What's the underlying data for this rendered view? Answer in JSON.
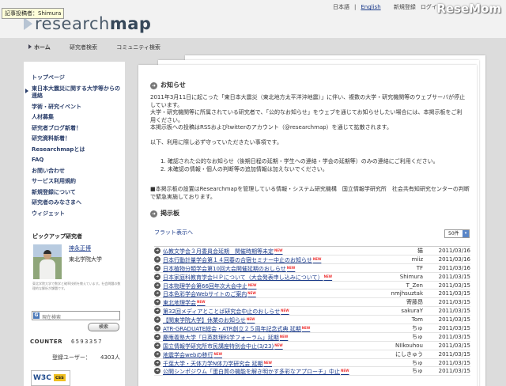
{
  "header": {
    "tooltip": "記事投稿者：Shimura",
    "logo_light": "research",
    "logo_bold": "map",
    "lang_ja": "日本語",
    "lang_sep": "|",
    "lang_en": "English",
    "signup": "新規登録",
    "login": "ログイン",
    "brand": "ReseMom"
  },
  "nav": {
    "home": "ホーム",
    "search": "研究者検索",
    "community": "コミュニティ検索"
  },
  "sidebar": {
    "items": [
      {
        "label": "トップページ"
      },
      {
        "label": "東日本大震災に関する大学等からの連絡"
      },
      {
        "label": "学術・研究イベント"
      },
      {
        "label": "人材募集"
      },
      {
        "label": "研究者ブログ新着！"
      },
      {
        "label": "研究資料新着！"
      },
      {
        "label": "Researchmapとは"
      },
      {
        "label": "FAQ"
      },
      {
        "label": "お問い合わせ"
      },
      {
        "label": "サービス利用規約"
      },
      {
        "label": "新規登録について"
      },
      {
        "label": "研究者のみなさまへ"
      },
      {
        "label": "ウィジェット"
      }
    ],
    "pickup_title": "ピックアップ研究者",
    "pickup_name": "神永正博",
    "pickup_affiliation": "東北学院大学",
    "pickup_desc": "東北学院大学で数学と確率技術を教えています。社会問題の数理的な解析が課題です。",
    "search_placeholder": "現在検索",
    "search_button": "検索",
    "counter_label": "COUNTER",
    "counter_value": "6593357",
    "registered_label": "登録ユーザー：",
    "registered_value": "4303人",
    "w3c": "W3C",
    "css_badge": "css"
  },
  "notice": {
    "title": "お知らせ",
    "p1": "2011年3月11日に起こった「東日本大震災（東北地方太平洋沖地震）」に伴い、複数の大学・研究機関等のウェブサーバが停止しています。",
    "p2": "大学・研究機関等に所属されている研究者で、「公的なお知らせ」をウェブを通じてお知らせしたい場合には、本掲示板をご利用ください。",
    "p3": "本掲示板への投稿はRSSおよびtwitterのアカウント（@researchmap）を通じて拡散されます。",
    "p4": "以下、利用に際し必ず守っていただきたい事項です。",
    "rule1": "1.  確認された公的なお知らせ（後期日程の延期・学生への連絡・学会の延期等）のみの連絡にご利用ください。",
    "rule2": "2.  未確認の情報・個人の判断等の追加情報は加えないでください。",
    "foot": "■本掲示板の設置はResearchmapを管理している情報・システム研究機構　国立情報学研究所　社会共有知研究センターの判断で緊急実施しております。"
  },
  "board": {
    "title": "掲示板",
    "flat_view": "フラット表示へ",
    "per_page": "50件",
    "new_badge": "NEW",
    "rows": [
      {
        "title": "仏教文学会３月委員会延期　関催時期等未定",
        "author": "猫",
        "date": "2011/03/16"
      },
      {
        "title": "日本行動計量学会第１４回春の合宿セミナー中止のお知らせ",
        "author": "miiz",
        "date": "2011/03/16"
      },
      {
        "title": "日本植物分類学会第10回大会開催延期のおしらせ",
        "author": "TF",
        "date": "2011/03/16"
      },
      {
        "title": "日本家庭科教育学会ＨＰについて（大会発表申し込みについて）",
        "author": "Shimura",
        "date": "2011/03/15"
      },
      {
        "title": "日本物理学会第66回年次大会中止",
        "author": "T_Zen",
        "date": "2011/03/15"
      },
      {
        "title": "日本色彩学会Webサイトのご案内",
        "author": "nmjhsuztak",
        "date": "2011/03/15"
      },
      {
        "title": "東北地理学会",
        "author": "寄藤昂",
        "date": "2011/03/15"
      },
      {
        "title": "第32回メディアとことば研究会中止のおしらせ",
        "author": "sakuraY",
        "date": "2011/03/15"
      },
      {
        "title": "【関東学院大学】休業のお知らせ",
        "author": "Tom",
        "date": "2011/03/15"
      },
      {
        "title": "ATR-GRADUATE総会・ATR創立２５周年記念式典 延期",
        "author": "ちゅ",
        "date": "2011/03/15"
      },
      {
        "title": "慶應義塾大学「日英数理科学フォーラム」延期",
        "author": "ちゅ",
        "date": "2011/03/15"
      },
      {
        "title": "国立情報学研究所市民講座特別会中止(3/23)",
        "author": "NIIkouhou",
        "date": "2011/03/15"
      },
      {
        "title": "地震学会webの移行",
        "author": "にしきゅう",
        "date": "2011/03/15"
      },
      {
        "title": "千葉大学・天体力学N体力学研究会 延期",
        "author": "ちゅ",
        "date": "2011/03/15"
      },
      {
        "title": "公開シンポジウム「蛋白質の機能を解き明かす多彩なアプローチ」中止",
        "author": "ちゅ",
        "date": "2011/03/15"
      }
    ]
  }
}
